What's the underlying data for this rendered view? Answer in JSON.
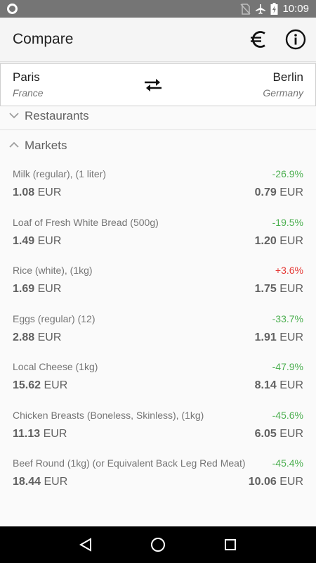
{
  "status_bar": {
    "time": "10:09",
    "icons": [
      "circle-icon",
      "no-sim-icon",
      "airplane-icon",
      "battery-charging-icon"
    ]
  },
  "app_bar": {
    "title": "Compare",
    "actions": [
      "euro-icon",
      "info-icon"
    ]
  },
  "cities": {
    "left": {
      "name": "Paris",
      "country": "France"
    },
    "right": {
      "name": "Berlin",
      "country": "Germany"
    }
  },
  "sections": {
    "restaurants": {
      "label": "Restaurants",
      "expanded": false
    },
    "markets": {
      "label": "Markets",
      "expanded": true
    }
  },
  "colors": {
    "negative_diff": "#4caf50",
    "positive_diff": "#e53935"
  },
  "items": [
    {
      "name": "Milk (regular), (1 liter)",
      "diff": "-26.9%",
      "diff_dir": "down",
      "left_num": "1.08",
      "right_num": "0.79",
      "currency": "EUR"
    },
    {
      "name": "Loaf of Fresh White Bread (500g)",
      "diff": "-19.5%",
      "diff_dir": "down",
      "left_num": "1.49",
      "right_num": "1.20",
      "currency": "EUR"
    },
    {
      "name": "Rice (white), (1kg)",
      "diff": "+3.6%",
      "diff_dir": "up",
      "left_num": "1.69",
      "right_num": "1.75",
      "currency": "EUR"
    },
    {
      "name": "Eggs (regular) (12)",
      "diff": "-33.7%",
      "diff_dir": "down",
      "left_num": "2.88",
      "right_num": "1.91",
      "currency": "EUR"
    },
    {
      "name": "Local Cheese (1kg)",
      "diff": "-47.9%",
      "diff_dir": "down",
      "left_num": "15.62",
      "right_num": "8.14",
      "currency": "EUR"
    },
    {
      "name": "Chicken Breasts (Boneless, Skinless), (1kg)",
      "diff": "-45.6%",
      "diff_dir": "down",
      "left_num": "11.13",
      "right_num": "6.05",
      "currency": "EUR"
    },
    {
      "name": "Beef Round (1kg) (or Equivalent Back Leg Red Meat)",
      "diff": "-45.4%",
      "diff_dir": "down",
      "left_num": "18.44",
      "right_num": "10.06",
      "currency": "EUR"
    }
  ],
  "nav_bar": [
    "back-icon",
    "home-icon",
    "recents-icon"
  ]
}
